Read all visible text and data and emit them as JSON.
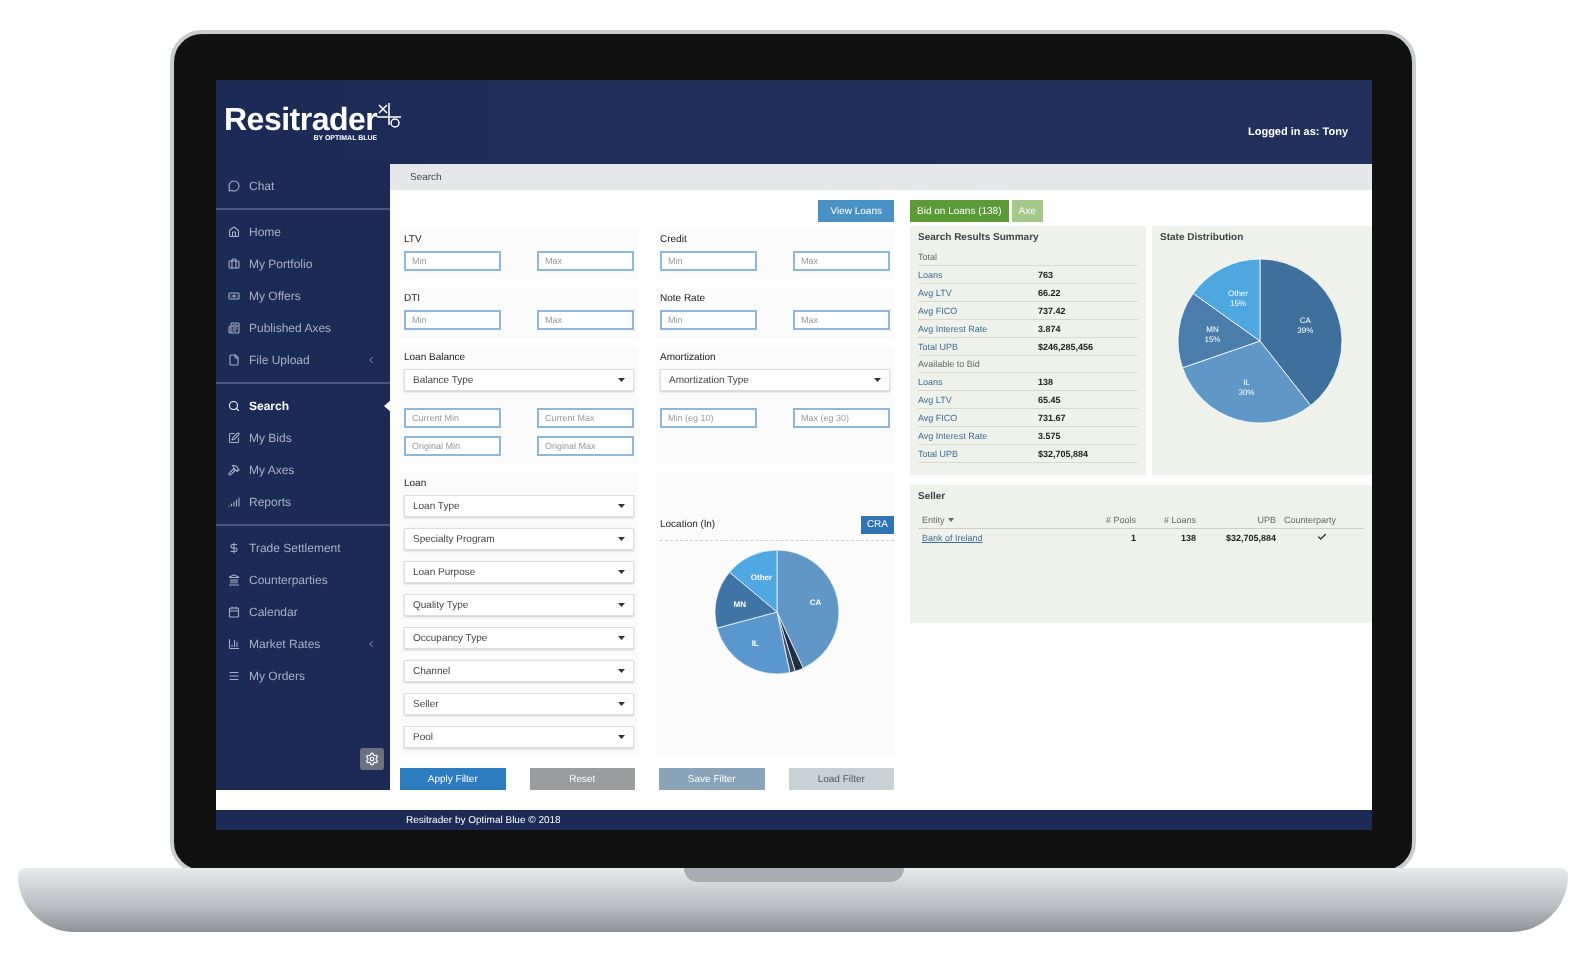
{
  "header": {
    "logo": "Resitrader",
    "logo_tagline": "BY OPTIMAL BLUE",
    "user": "Logged in as: Tony"
  },
  "sidebar": {
    "groups": [
      {
        "items": [
          {
            "label": "Chat",
            "selected": false,
            "has_submenu": false
          }
        ]
      },
      {
        "items": [
          {
            "label": "Home",
            "selected": false,
            "has_submenu": false
          },
          {
            "label": "My Portfolio",
            "selected": false,
            "has_submenu": false
          },
          {
            "label": "My Offers",
            "selected": false,
            "has_submenu": false
          },
          {
            "label": "Published Axes",
            "selected": false,
            "has_submenu": false
          },
          {
            "label": "File Upload",
            "selected": false,
            "has_submenu": true
          }
        ]
      },
      {
        "items": [
          {
            "label": "Search",
            "selected": true,
            "has_submenu": false
          },
          {
            "label": "My Bids",
            "selected": false,
            "has_submenu": false
          },
          {
            "label": "My Axes",
            "selected": false,
            "has_submenu": false
          },
          {
            "label": "Reports",
            "selected": false,
            "has_submenu": false
          }
        ]
      },
      {
        "items": [
          {
            "label": "Trade Settlement",
            "selected": false,
            "has_submenu": false
          },
          {
            "label": "Counterparties",
            "selected": false,
            "has_submenu": false
          },
          {
            "label": "Calendar",
            "selected": false,
            "has_submenu": false
          },
          {
            "label": "Market Rates",
            "selected": false,
            "has_submenu": true
          },
          {
            "label": "My Orders",
            "selected": false,
            "has_submenu": false
          }
        ]
      }
    ]
  },
  "breadcrumb": "Search",
  "view_loans": "View Loans",
  "filter_groups": [
    {
      "kind": "range",
      "label": "LTV",
      "placeholders": [
        "Min",
        "Max"
      ]
    },
    {
      "kind": "range",
      "label": "Credit",
      "placeholders": [
        "Min",
        "Max"
      ]
    },
    {
      "kind": "range",
      "label": "DTI",
      "placeholders": [
        "Min",
        "Max"
      ]
    },
    {
      "kind": "range",
      "label": "Note Rate",
      "placeholders": [
        "Min",
        "Max"
      ]
    },
    {
      "kind": "select_range",
      "label": "Loan Balance",
      "select": "Balance Type",
      "placeholders": [
        "Current Min",
        "Current Max",
        "Original Min",
        "Original Max"
      ]
    },
    {
      "kind": "select_range",
      "label": "Amortization",
      "select": "Amortization Type",
      "placeholders": [
        "Min (eg 10)",
        "Max (eg 30)"
      ]
    },
    {
      "kind": "selects",
      "label": "Loan",
      "selects": [
        "Loan Type",
        "Specialty Program",
        "Loan Purpose",
        "Quality Type",
        "Occupancy Type",
        "Channel",
        "Seller",
        "Pool"
      ]
    },
    {
      "kind": "chart",
      "label": "Location (ln)",
      "toggle": "CRA",
      "slice_labels": [
        "CA",
        "IL",
        "MN",
        "Other"
      ]
    }
  ],
  "filter_buttons": [
    {
      "label": "Apply Filter",
      "kind": "primary"
    },
    {
      "label": "Reset",
      "kind": "secondary"
    },
    {
      "label": "Save Filter",
      "kind": "tertiary"
    },
    {
      "label": "Load Filter",
      "kind": "muted"
    }
  ],
  "result_tabs": [
    {
      "label": "Bid on Loans (138)",
      "selected": true
    },
    {
      "label": "Axe",
      "selected": false
    }
  ],
  "summary": {
    "title": "Search Results Summary",
    "sections": [
      {
        "title": "Total",
        "rows": [
          [
            "Loans",
            "763"
          ],
          [
            "Avg LTV",
            "66.22"
          ],
          [
            "Avg FICO",
            "737.42"
          ],
          [
            "Avg Interest Rate",
            "3.874"
          ],
          [
            "Total UPB",
            "$246,285,456"
          ]
        ]
      },
      {
        "title": "Available to Bid",
        "rows": [
          [
            "Loans",
            "138"
          ],
          [
            "Avg LTV",
            "65.45"
          ],
          [
            "Avg FICO",
            "731.67"
          ],
          [
            "Avg Interest Rate",
            "3.575"
          ],
          [
            "Total UPB",
            "$32,705,884"
          ]
        ]
      }
    ]
  },
  "state_distribution": {
    "chart_data": {
      "type": "pie",
      "title": "State Distribution",
      "categories": [
        "CA",
        "IL",
        "MN",
        "Other"
      ],
      "values": [
        39,
        30,
        15,
        15
      ],
      "value_labels": [
        "39%",
        "30%",
        "15%",
        "15%"
      ],
      "data_labels": true
    }
  },
  "seller": {
    "title": "Seller",
    "columns": [
      "Entity",
      "# Pools",
      "# Loans",
      "UPB",
      "Counterparty"
    ],
    "rows": [
      {
        "entity": "Bank of Ireland",
        "pools": "1",
        "loans": "138",
        "upb": "$32,705,884",
        "counterparty": true
      }
    ]
  },
  "footer": "Resitrader by Optimal Blue © 2018"
}
